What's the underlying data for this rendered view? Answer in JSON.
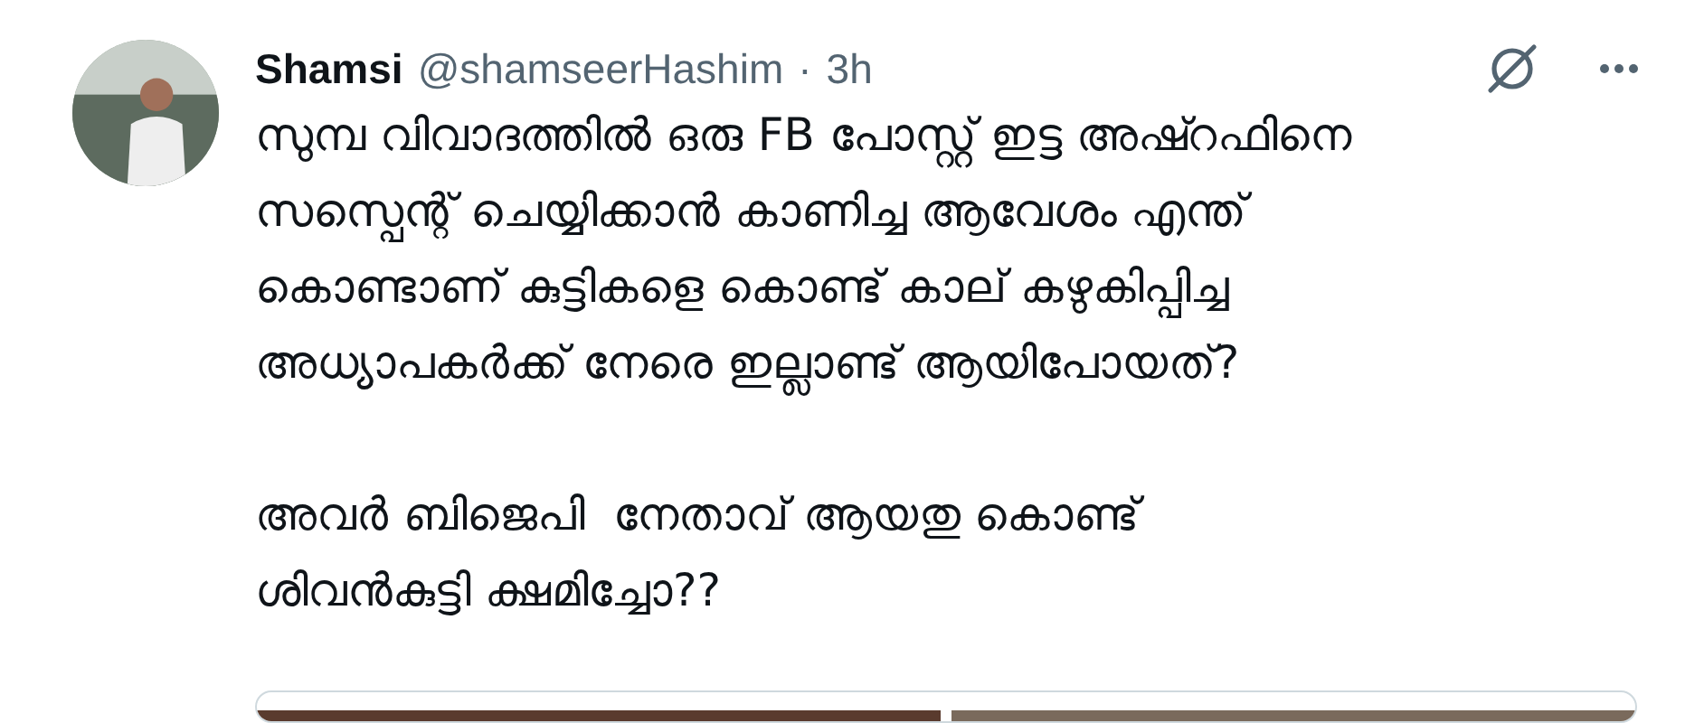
{
  "tweet": {
    "display_name": "Shamsi",
    "handle": "@shamseerHashim",
    "separator": "·",
    "time": "3h",
    "paragraphs": [
      "സുമ്പ വിവാദത്തിൽ ഒരു FB പോസ്റ്റ് ഇട്ട അഷ്റഫിനെ\nസസ്പെന്റ് ചെയ്യിക്കാൻ കാണിച്ച ആവേശം എന്ത്\nകൊണ്ടാണ് കുട്ടികളെ കൊണ്ട് കാല് കഴുകിപ്പിച്ച\nഅധ്യാപകർക്ക് നേരെ ഇല്ലാണ്ട് ആയിപോയത്?",
      "അവർ ബിജെപി  നേതാവ് ആയതു കൊണ്ട്\nശിവൻകുട്ടി ക്ഷമിച്ചോ??"
    ]
  }
}
